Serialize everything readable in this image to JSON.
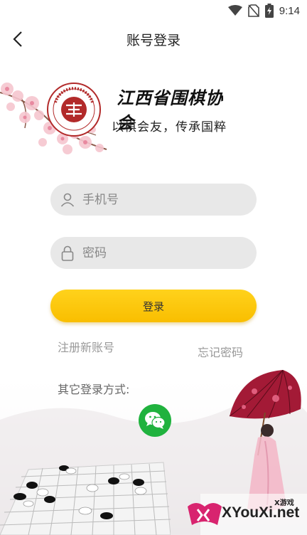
{
  "status_bar": {
    "time": "9:14"
  },
  "header": {
    "title": "账号登录"
  },
  "brand": {
    "name": "江西省围棋协会",
    "slogan": "以棋会友，传承国粹",
    "logo_ring_text": "JIANGXI WEIQI ASSOCIATION"
  },
  "form": {
    "phone_placeholder": "手机号",
    "password_placeholder": "密码",
    "login_label": "登录"
  },
  "links": {
    "register": "注册新账号",
    "forgot": "忘记密码"
  },
  "other_login": {
    "label": "其它登录方式:"
  },
  "watermark": {
    "text": "XYouXi.net",
    "small": "X游戏"
  },
  "colors": {
    "accent": "#f9be00",
    "wechat": "#20b23e",
    "field_bg": "#e8e8e8"
  }
}
